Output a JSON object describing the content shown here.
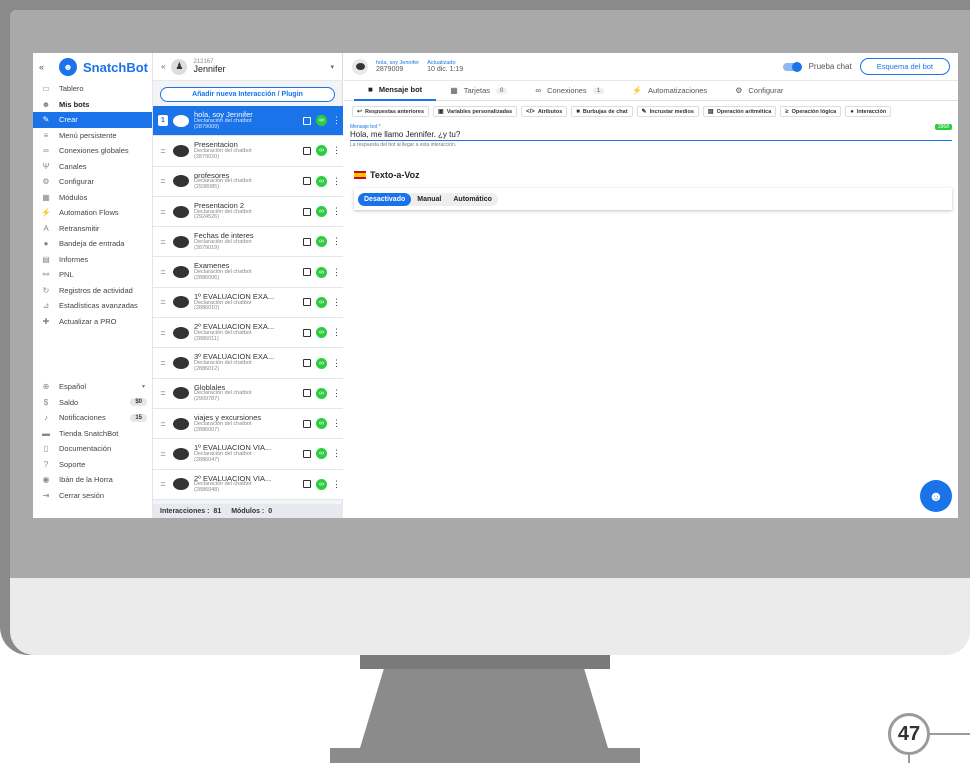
{
  "nav": {
    "brand": "SnatchBot",
    "collapse": "«",
    "items": [
      {
        "label": "Tablero",
        "icon": "dashboard-icon",
        "glyph": "▭"
      },
      {
        "label": "Mis bots",
        "icon": "bot-icon",
        "glyph": "☻",
        "bold": true
      },
      {
        "label": "Crear",
        "icon": "edit-icon",
        "glyph": "✎",
        "active": true
      },
      {
        "label": "Menú persistente",
        "icon": "menu-icon",
        "glyph": "≡"
      },
      {
        "label": "Conexiones globales",
        "icon": "link-icon",
        "glyph": "∞"
      },
      {
        "label": "Canales",
        "icon": "channels-icon",
        "glyph": "Ψ"
      },
      {
        "label": "Configurar",
        "icon": "gear-icon",
        "glyph": "⚙"
      },
      {
        "label": "Módulos",
        "icon": "modules-icon",
        "glyph": "▦"
      },
      {
        "label": "Automation Flows",
        "icon": "flow-icon",
        "glyph": "⚡"
      },
      {
        "label": "Retransmitir",
        "icon": "broadcast-icon",
        "glyph": "A"
      },
      {
        "label": "Bandeja de entrada",
        "icon": "inbox-icon",
        "glyph": "●"
      },
      {
        "label": "Informes",
        "icon": "reports-icon",
        "glyph": "▤"
      },
      {
        "label": "PNL",
        "icon": "nlp-icon",
        "glyph": "⚯"
      },
      {
        "label": "Registros de actividad",
        "icon": "history-icon",
        "glyph": "↻"
      },
      {
        "label": "Estadísticas avanzadas",
        "icon": "stats-icon",
        "glyph": "⊿"
      },
      {
        "label": "Actualizar a PRO",
        "icon": "pro-icon",
        "glyph": "✚"
      }
    ],
    "bottom": [
      {
        "label": "Español",
        "icon": "globe-icon",
        "glyph": "⊕",
        "dropdown": "▾"
      },
      {
        "label": "Saldo",
        "icon": "dollar-icon",
        "glyph": "$",
        "count": "$0"
      },
      {
        "label": "Notificaciones",
        "icon": "bell-icon",
        "glyph": "♪",
        "count": "15"
      },
      {
        "label": "Tienda SnatchBot",
        "icon": "store-icon",
        "glyph": "▬"
      },
      {
        "label": "Documentación",
        "icon": "doc-icon",
        "glyph": "▯"
      },
      {
        "label": "Soporte",
        "icon": "help-icon",
        "glyph": "?"
      },
      {
        "label": "Ibán de la Horra",
        "icon": "user-icon",
        "glyph": "◉"
      },
      {
        "label": "Cerrar sesión",
        "icon": "logout-icon",
        "glyph": "⇥"
      }
    ]
  },
  "list": {
    "bot_id": "212167",
    "bot_name": "Jennifer",
    "add_button": "Añadir nueva Interacción / Plugin",
    "rows": [
      {
        "num": "1",
        "title": "hola, soy Jennifer",
        "subtitle": "Declaración del chatbot",
        "id": "(2879009)",
        "selected": true
      },
      {
        "title": "Presentacion",
        "subtitle": "Declaración del chatbot",
        "id": "(2879020)"
      },
      {
        "title": "profesores",
        "subtitle": "Declaración del chatbot",
        "id": "(2938085)"
      },
      {
        "title": "Presentacion 2",
        "subtitle": "Declaración del chatbot",
        "id": "(2924526)"
      },
      {
        "title": "Fechas de interes",
        "subtitle": "Declaración del chatbot",
        "id": "(2879019)"
      },
      {
        "title": "Examenes",
        "subtitle": "Declaración del chatbot",
        "id": "(2886006)"
      },
      {
        "title": "1º EVALUACION EXA...",
        "subtitle": "Declaración del chatbot",
        "id": "(2886010)"
      },
      {
        "title": "2º EVALUACION EXA...",
        "subtitle": "Declaración del chatbot",
        "id": "(2886011)"
      },
      {
        "title": "3º EVALUACION EXA...",
        "subtitle": "Declaración del chatbot",
        "id": "(2886012)"
      },
      {
        "title": "Globlales",
        "subtitle": "Declaración del chatbot",
        "id": "(2909787)"
      },
      {
        "title": "viajes y excursiones",
        "subtitle": "Declaración del chatbot",
        "id": "(2886007)"
      },
      {
        "title": "1º EVALUACION VIA...",
        "subtitle": "Declaración del chatbot",
        "id": "(2886047)"
      },
      {
        "title": "2º EVALUACION VIA...",
        "subtitle": "Declaración del chatbot",
        "id": "(2886048)"
      }
    ],
    "footer": {
      "interactions_label": "Interacciones :",
      "interactions": "81",
      "modules_label": "Módulos :",
      "modules": "0"
    }
  },
  "main": {
    "top": {
      "name": "hola, soy Jennifer",
      "id": "2879009",
      "updated_label": "Actualizado",
      "updated": "10 dic. 1:19",
      "test_label": "Prueba chat",
      "schema_button": "Esquema del bot"
    },
    "tabs": [
      {
        "label": "Mensaje bot",
        "active": true,
        "glyph": "■"
      },
      {
        "label": "Tarjetas",
        "count": "0",
        "glyph": "▦"
      },
      {
        "label": "Conexiones",
        "count": "1",
        "glyph": "∞"
      },
      {
        "label": "Automatizaciones",
        "glyph": "⚡"
      },
      {
        "label": "Configurar",
        "glyph": "⚙"
      }
    ],
    "chips": [
      {
        "label": "Respuestas anteriores",
        "glyph": "↩"
      },
      {
        "label": "Variables personalizadas",
        "glyph": "▣"
      },
      {
        "label": "Atributos",
        "glyph": "</>"
      },
      {
        "label": "Burbujas de chat",
        "glyph": "■"
      },
      {
        "label": "Incrustar medios",
        "glyph": "✎"
      },
      {
        "label": "Operación aritmética",
        "glyph": "▤"
      },
      {
        "label": "Operación lógica",
        "glyph": "≥"
      },
      {
        "label": "Interacción",
        "glyph": "●"
      }
    ],
    "message": {
      "label": "Mensaje bot *",
      "value": "Hola,  me llamo Jennifer. ¿y tu?",
      "counter": "3968",
      "help": "La respuesta del bot al llegar a esta interacción."
    },
    "tts": {
      "title": "Texto-a-Voz",
      "options": [
        "Desactivado",
        "Manual",
        "Automático"
      ],
      "selected": "Desactivado"
    }
  },
  "page_number": "47",
  "colors": {
    "accent": "#1a73e8",
    "success": "#2ecc40"
  }
}
